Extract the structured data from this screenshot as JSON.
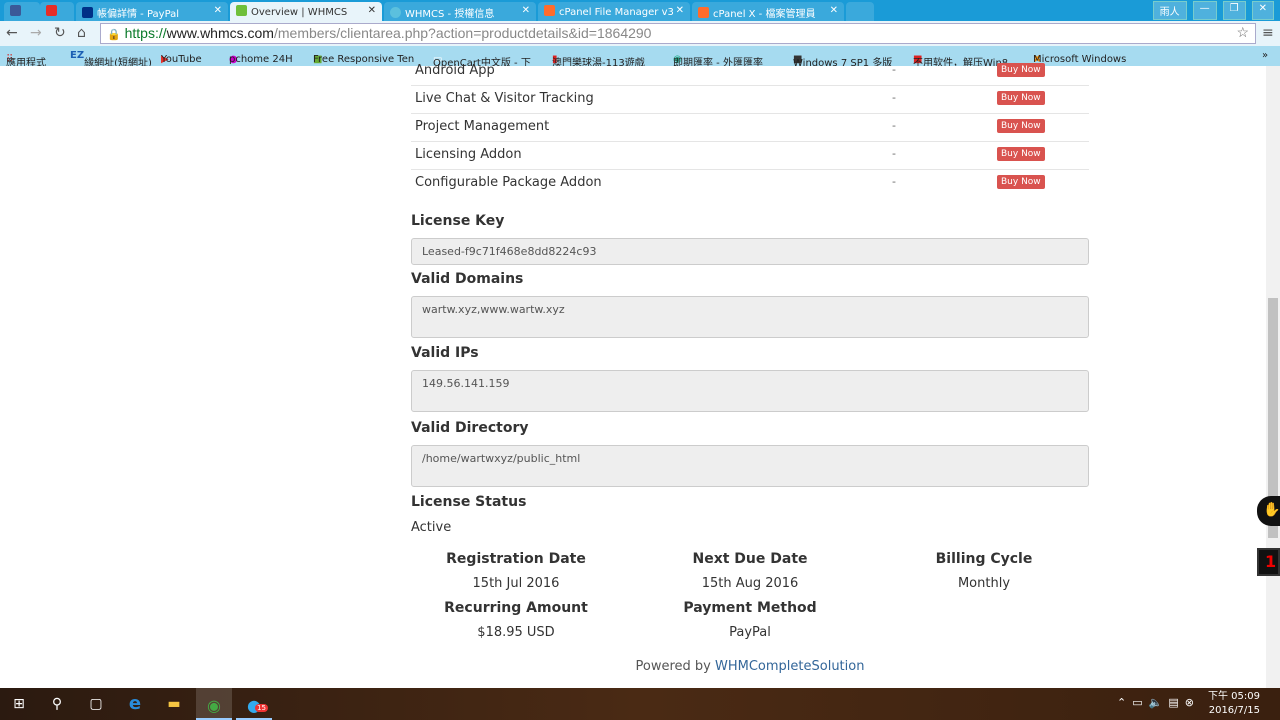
{
  "browser": {
    "tabs": [
      {
        "label": "",
        "icon": "facebook-icon",
        "color": "#3b5998"
      },
      {
        "label": "",
        "icon": "youtube-icon",
        "color": "#e52d27"
      },
      {
        "label": "帳偏詳情 - PayPal",
        "icon": "paypal-icon",
        "color": "#003087"
      },
      {
        "label": "Overview | WHMCS",
        "icon": "whmcs-icon",
        "color": "#6fbf3a",
        "active": true
      },
      {
        "label": "WHMCS - 授權信息",
        "icon": "whmcs-blue-icon",
        "color": "#5bc0de"
      },
      {
        "label": "cPanel File Manager v3",
        "icon": "cpanel-icon",
        "color": "#ff6c2c"
      },
      {
        "label": "cPanel X - 檔案管理員",
        "icon": "cpanel-icon",
        "color": "#ff6c2c"
      }
    ],
    "user": "雨人",
    "url": {
      "scheme": "https://",
      "host": "www.whmcs.com",
      "path": "/members/clientarea.php?action=productdetails&id=1864290"
    },
    "bookmarks": [
      "應用程式",
      "緣網址(短網址)",
      "YouTube",
      "pchome 24H",
      "Free Responsive Ten",
      "OpenCart中文版 - 下",
      "澳門樂球湯-113遊戲",
      "即期匯率 - 外匯匯率",
      "Windows 7 SP1 多版",
      "不用软件，解压Win8",
      "Microsoft Windows"
    ]
  },
  "addons": [
    {
      "name": "Android App",
      "price": "-",
      "action": "Buy Now"
    },
    {
      "name": "Live Chat & Visitor Tracking",
      "price": "-",
      "action": "Buy Now"
    },
    {
      "name": "Project Management",
      "price": "-",
      "action": "Buy Now"
    },
    {
      "name": "Licensing Addon",
      "price": "-",
      "action": "Buy Now"
    },
    {
      "name": "Configurable Package Addon",
      "price": "-",
      "action": "Buy Now"
    }
  ],
  "license": {
    "key_label": "License Key",
    "key": "Leased-f9c71f468e8dd8224c93",
    "domains_label": "Valid Domains",
    "domains": "wartw.xyz,www.wartw.xyz",
    "ips_label": "Valid IPs",
    "ips": "149.56.141.159",
    "dir_label": "Valid Directory",
    "dir": "/home/wartwxyz/public_html",
    "status_label": "License Status",
    "status": "Active"
  },
  "details": {
    "reg_label": "Registration Date",
    "reg": "15th Jul 2016",
    "due_label": "Next Due Date",
    "due": "15th Aug 2016",
    "cycle_label": "Billing Cycle",
    "cycle": "Monthly",
    "amount_label": "Recurring Amount",
    "amount": "$18.95 USD",
    "method_label": "Payment Method",
    "method": "PayPal"
  },
  "footer": {
    "prefix": "Powered by ",
    "link": "WHMCompleteSolution"
  },
  "taskbar": {
    "time": "下午 05:09",
    "date": "2016/7/15",
    "badge": "15"
  }
}
